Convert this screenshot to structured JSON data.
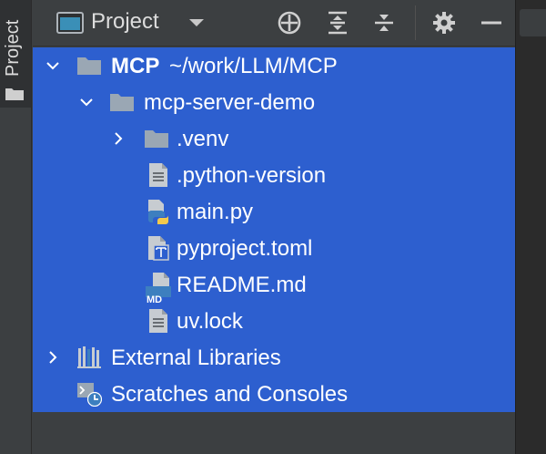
{
  "sidebar": {
    "tab_label": "Project"
  },
  "header": {
    "title": "Project"
  },
  "tree": {
    "root": {
      "name": "MCP",
      "path": "~/work/LLM/MCP"
    },
    "items": [
      {
        "label": "mcp-server-demo"
      },
      {
        "label": ".venv"
      },
      {
        "label": ".python-version"
      },
      {
        "label": "main.py"
      },
      {
        "label": "pyproject.toml"
      },
      {
        "label": "README.md"
      },
      {
        "label": "uv.lock"
      },
      {
        "label": "External Libraries"
      },
      {
        "label": "Scratches and Consoles"
      }
    ],
    "md_badge": "MD"
  },
  "colors": {
    "selection": "#2d5fcf",
    "panel_bg": "#3c3f41",
    "folder": "#9aa7b4",
    "python_blue": "#3d7fbf",
    "python_yellow": "#f2c94c"
  }
}
